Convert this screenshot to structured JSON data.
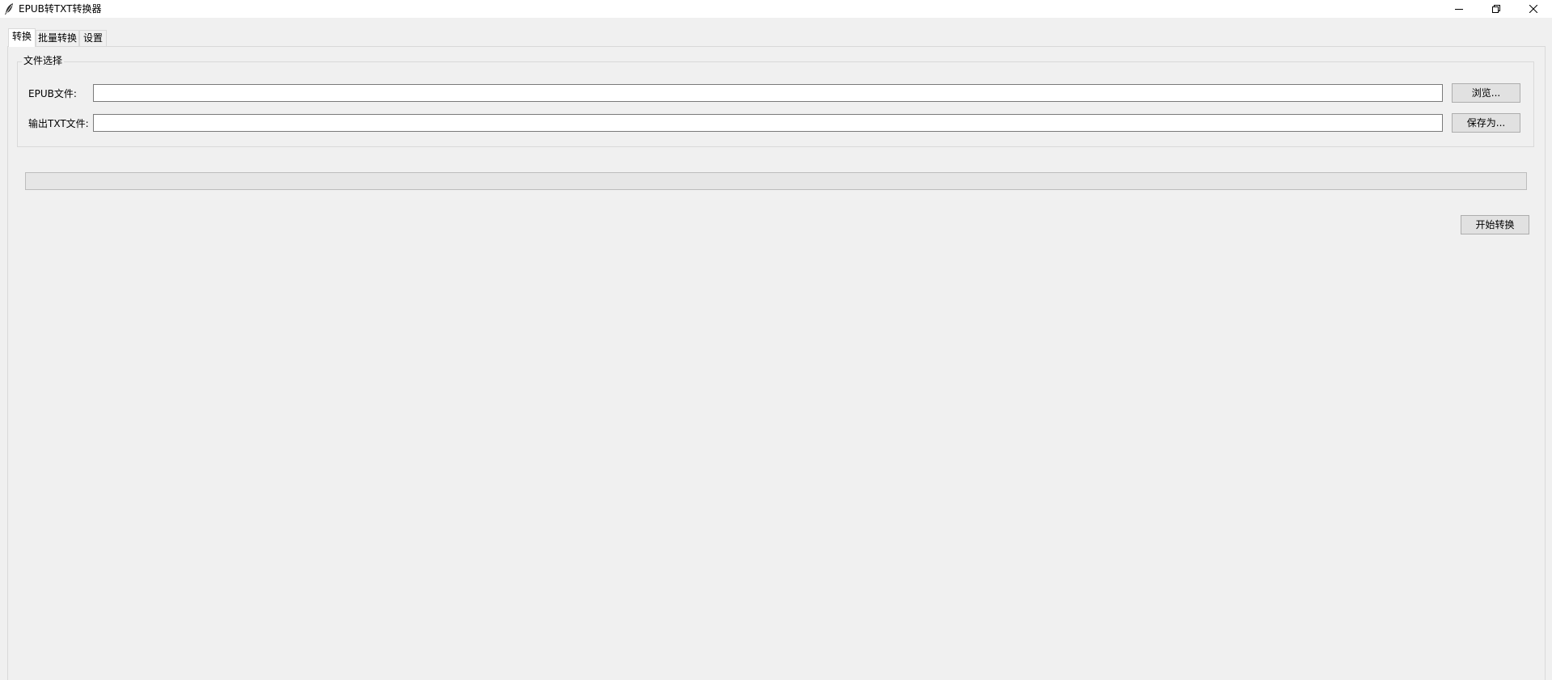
{
  "window": {
    "title": "EPUB转TXT转换器",
    "controls": {
      "minimize_icon": "minimize-icon",
      "maximize_icon": "restore-icon",
      "close_icon": "close-icon"
    }
  },
  "tabs": [
    {
      "label": "转换",
      "active": true
    },
    {
      "label": "批量转换",
      "active": false
    },
    {
      "label": "设置",
      "active": false
    }
  ],
  "file_selection": {
    "group_title": "文件选择",
    "epub_label": "EPUB文件:",
    "epub_value": "",
    "txt_label": "输出TXT文件:",
    "txt_value": "",
    "browse_label": "浏览...",
    "saveas_label": "保存为..."
  },
  "progress": {
    "value_percent": 0
  },
  "actions": {
    "start_label": "开始转换"
  }
}
